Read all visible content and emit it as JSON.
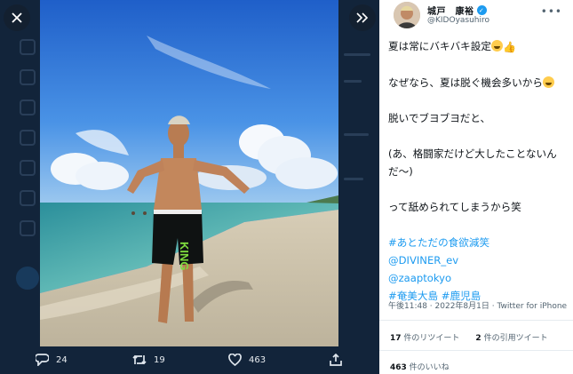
{
  "overlay": {
    "close_icon": "close-icon",
    "expand_icon": "double-chevron-right-icon",
    "actions": {
      "reply_count": "24",
      "retweet_count": "19",
      "like_count": "463"
    }
  },
  "author": {
    "name": "城戸　康裕",
    "handle": "@KIDOyasuhiro",
    "verified": true
  },
  "tweet": {
    "line1": "夏は常にバキバキ設定",
    "line2": "なぜなら、夏は脱ぐ機会多いから",
    "line3": "脱いでブヨブヨだと、",
    "line4": "(あ、格闘家だけど大したことないんだ〜)",
    "line5": "って舐められてしまうから笑",
    "tags": [
      "#あとただの食欲減笑",
      "@DIVINER_ev",
      "@zaaptokyo",
      "#奄美大島",
      "#鹿児島"
    ],
    "timestamp": "午後11:48 · 2022年8月1日 · Twitter for iPhone"
  },
  "stats": {
    "retweets_count": "17",
    "retweets_label": "件のリツイート",
    "quotes_count": "2",
    "quotes_label": "件の引用ツイート",
    "likes_count": "463",
    "likes_label": "件のいいね"
  },
  "colors": {
    "accent": "#1d9bf0",
    "overlay_bg": "#12243a"
  }
}
